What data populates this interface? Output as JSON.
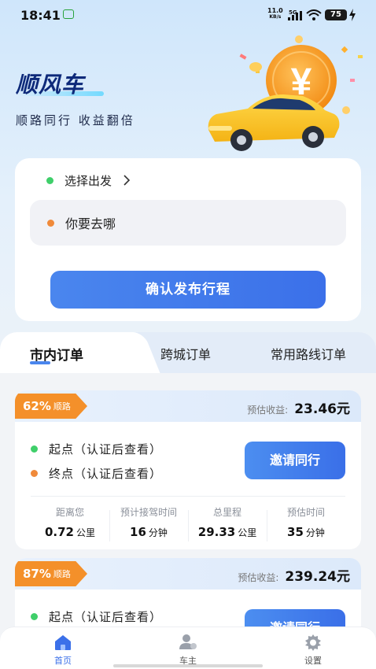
{
  "status_bar": {
    "time": "18:41",
    "net_speed": "11.0",
    "net_unit": "KB/s",
    "network": "5G",
    "battery": "75"
  },
  "hero": {
    "title": "顺风车",
    "subtitle": "顺路同行 收益翻倍"
  },
  "trip": {
    "origin_label": "选择出发",
    "destination_placeholder": "你要去哪",
    "confirm_label": "确认发布行程"
  },
  "tabs": [
    {
      "label": "市内订单",
      "active": true
    },
    {
      "label": "跨城订单",
      "active": false
    },
    {
      "label": "常用路线订单",
      "active": false
    }
  ],
  "orders": [
    {
      "percent": "62%",
      "tag": "顺路",
      "earn_label": "预估收益:",
      "earn_value": "23.46元",
      "start": "起点（认证后查看）",
      "end": "终点（认证后查看）",
      "invite_label": "邀请同行",
      "stats": [
        {
          "label": "距离您",
          "value": "0.72",
          "unit": "公里"
        },
        {
          "label": "预计接驾时间",
          "value": "16",
          "unit": "分钟"
        },
        {
          "label": "总里程",
          "value": "29.33",
          "unit": "公里"
        },
        {
          "label": "预估时间",
          "value": "35",
          "unit": "分钟"
        }
      ]
    },
    {
      "percent": "87%",
      "tag": "顺路",
      "earn_label": "预估收益:",
      "earn_value": "239.24元",
      "start": "起点（认证后查看）",
      "invite_label": "邀请同行"
    }
  ],
  "nav": [
    {
      "label": "首页",
      "icon": "home-icon",
      "active": true
    },
    {
      "label": "车主",
      "icon": "driver-icon",
      "active": false
    },
    {
      "label": "设置",
      "icon": "gear-icon",
      "active": false
    }
  ],
  "colors": {
    "accent": "#3b70e9",
    "badge": "#f4902a",
    "origin_dot": "#3fcf6a",
    "destination_dot": "#f08a3a"
  }
}
